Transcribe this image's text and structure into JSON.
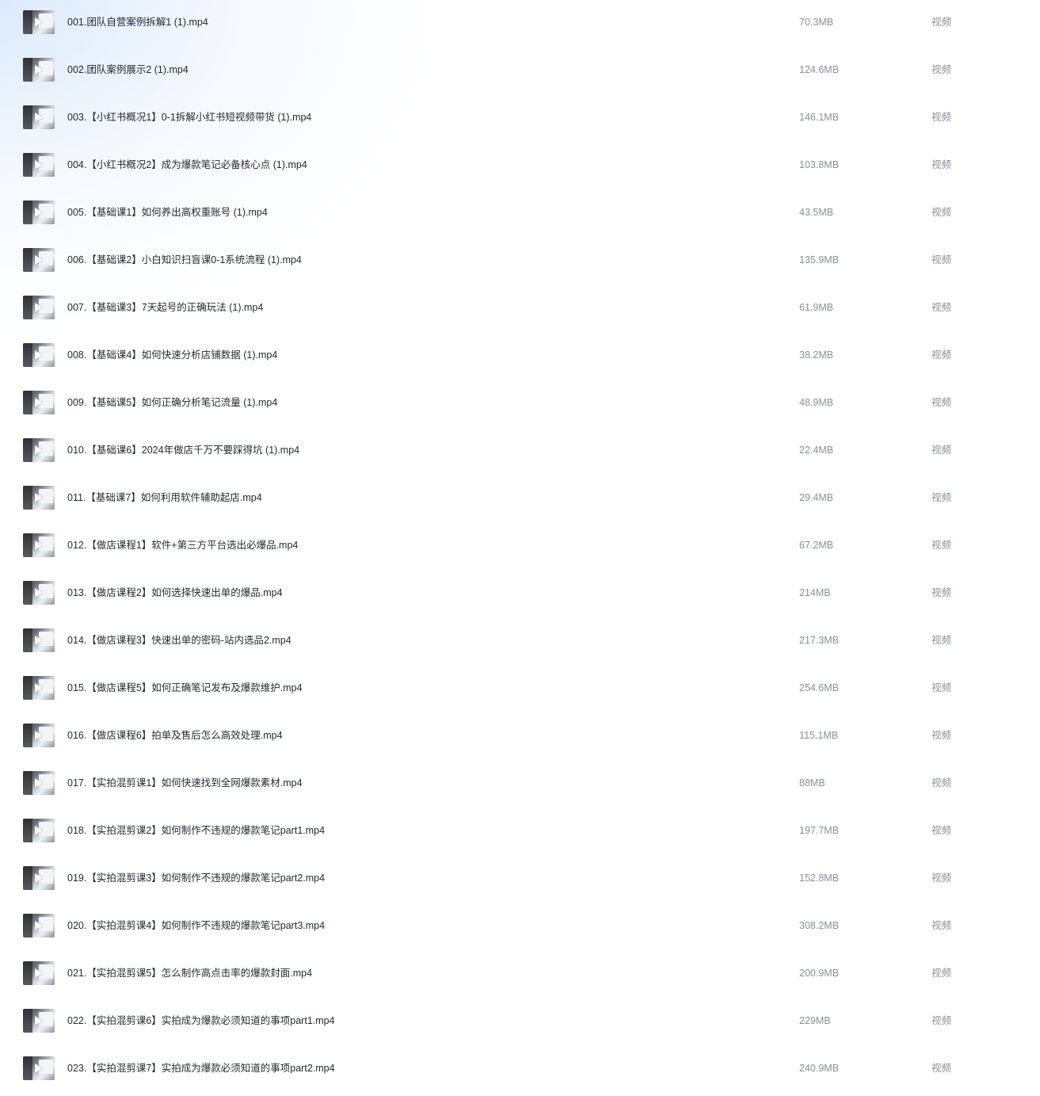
{
  "files": [
    {
      "name": "001.团队自营案例拆解1 (1).mp4",
      "size": "70.3MB",
      "type": "视频",
      "icon": "video-thumbnail-icon"
    },
    {
      "name": "002.团队案例展示2 (1).mp4",
      "size": "124.6MB",
      "type": "视频",
      "icon": "video-thumbnail-icon"
    },
    {
      "name": "003.【小红书概况1】0-1拆解小红书短视频带货 (1).mp4",
      "size": "146.1MB",
      "type": "视频",
      "icon": "video-thumbnail-icon"
    },
    {
      "name": "004.【小红书概况2】成为爆款笔记必备核心点 (1).mp4",
      "size": "103.8MB",
      "type": "视频",
      "icon": "video-thumbnail-icon"
    },
    {
      "name": "005.【基础课1】如何养出高权重账号 (1).mp4",
      "size": "43.5MB",
      "type": "视频",
      "icon": "video-thumbnail-icon"
    },
    {
      "name": "006.【基础课2】小白知识扫盲课0-1系统流程 (1).mp4",
      "size": "135.9MB",
      "type": "视频",
      "icon": "video-thumbnail-icon"
    },
    {
      "name": "007.【基础课3】7天起号的正确玩法 (1).mp4",
      "size": "61.9MB",
      "type": "视频",
      "icon": "video-thumbnail-icon"
    },
    {
      "name": "008.【基础课4】如何快速分析店铺数据 (1).mp4",
      "size": "38.2MB",
      "type": "视频",
      "icon": "video-thumbnail-icon"
    },
    {
      "name": "009.【基础课5】如何正确分析笔记流量 (1).mp4",
      "size": "48.9MB",
      "type": "视频",
      "icon": "video-thumbnail-icon"
    },
    {
      "name": "010.【基础课6】2024年做店千万不要踩得坑 (1).mp4",
      "size": "22.4MB",
      "type": "视频",
      "icon": "video-thumbnail-icon"
    },
    {
      "name": "011.【基础课7】如何利用软件辅助起店.mp4",
      "size": "29.4MB",
      "type": "视频",
      "icon": "video-thumbnail-icon"
    },
    {
      "name": "012.【做店课程1】软件+第三方平台选出必爆品.mp4",
      "size": "67.2MB",
      "type": "视频",
      "icon": "video-thumbnail-icon"
    },
    {
      "name": "013.【做店课程2】如何选择快速出单的爆品.mp4",
      "size": "214MB",
      "type": "视频",
      "icon": "video-thumbnail-icon"
    },
    {
      "name": "014.【做店课程3】快速出单的密码-站内选品2.mp4",
      "size": "217.3MB",
      "type": "视频",
      "icon": "video-thumbnail-icon"
    },
    {
      "name": "015.【做店课程5】如何正确笔记发布及爆款维护.mp4",
      "size": "254.6MB",
      "type": "视频",
      "icon": "video-thumbnail-icon"
    },
    {
      "name": "016.【做店课程6】拍单及售后怎么高效处理.mp4",
      "size": "115.1MB",
      "type": "视频",
      "icon": "video-thumbnail-icon"
    },
    {
      "name": "017.【实拍混剪课1】如何快速找到全网爆款素材.mp4",
      "size": "88MB",
      "type": "视频",
      "icon": "video-thumbnail-icon"
    },
    {
      "name": "018.【实拍混剪课2】如何制作不违规的爆款笔记part1.mp4",
      "size": "197.7MB",
      "type": "视频",
      "icon": "video-thumbnail-icon"
    },
    {
      "name": "019.【实拍混剪课3】如何制作不违规的爆款笔记part2.mp4",
      "size": "152.8MB",
      "type": "视频",
      "icon": "video-thumbnail-icon"
    },
    {
      "name": "020.【实拍混剪课4】如何制作不违规的爆款笔记part3.mp4",
      "size": "308.2MB",
      "type": "视频",
      "icon": "video-thumbnail-icon"
    },
    {
      "name": "021.【实拍混剪课5】怎么制作高点击率的爆款封面.mp4",
      "size": "200.9MB",
      "type": "视频",
      "icon": "video-thumbnail-icon"
    },
    {
      "name": "022.【实拍混剪课6】实拍成为爆款必须知道的事项part1.mp4",
      "size": "229MB",
      "type": "视频",
      "icon": "video-thumbnail-icon"
    },
    {
      "name": "023.【实拍混剪课7】实拍成为爆款必须知道的事项part2.mp4",
      "size": "240.9MB",
      "type": "视频",
      "icon": "video-thumbnail-icon"
    }
  ]
}
